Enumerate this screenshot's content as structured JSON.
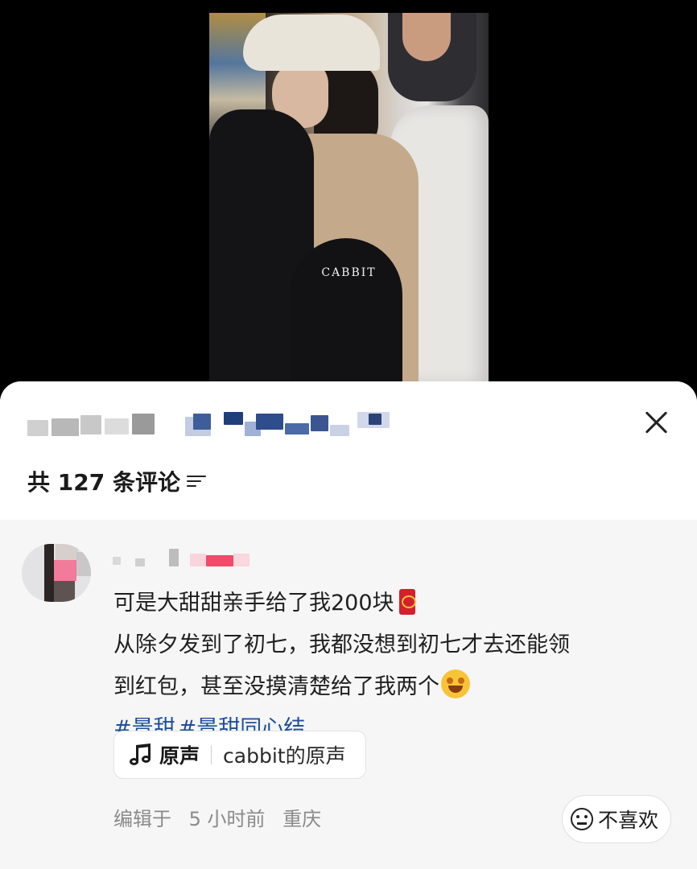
{
  "video": {
    "watermark": "CABBIT"
  },
  "sheet": {
    "comment_count_label": "共 127 条评论",
    "close_icon": "close-icon",
    "sort_icon": "sort-icon"
  },
  "comment": {
    "lines": [
      "可是大甜甜亲手给了我200块",
      "从除夕发到了初七，我都没想到初七才去还能领",
      "到红包，甚至没摸清楚给了我两个"
    ],
    "hashtags": [
      "#景甜",
      "#景甜同心结"
    ],
    "emoji_icons": [
      "red-envelope-icon",
      "starstruck-emoji-icon"
    ],
    "music": {
      "label": "原声",
      "name": "cabbit的原声"
    },
    "meta": {
      "edited": "编辑于",
      "time": "5 小时前",
      "location": "重庆"
    },
    "dislike_label": "不喜欢"
  },
  "colors": {
    "hashtag": "#1e4f9c",
    "meta_text": "#8a8a8a",
    "comment_bg": "#f6f6f6"
  }
}
